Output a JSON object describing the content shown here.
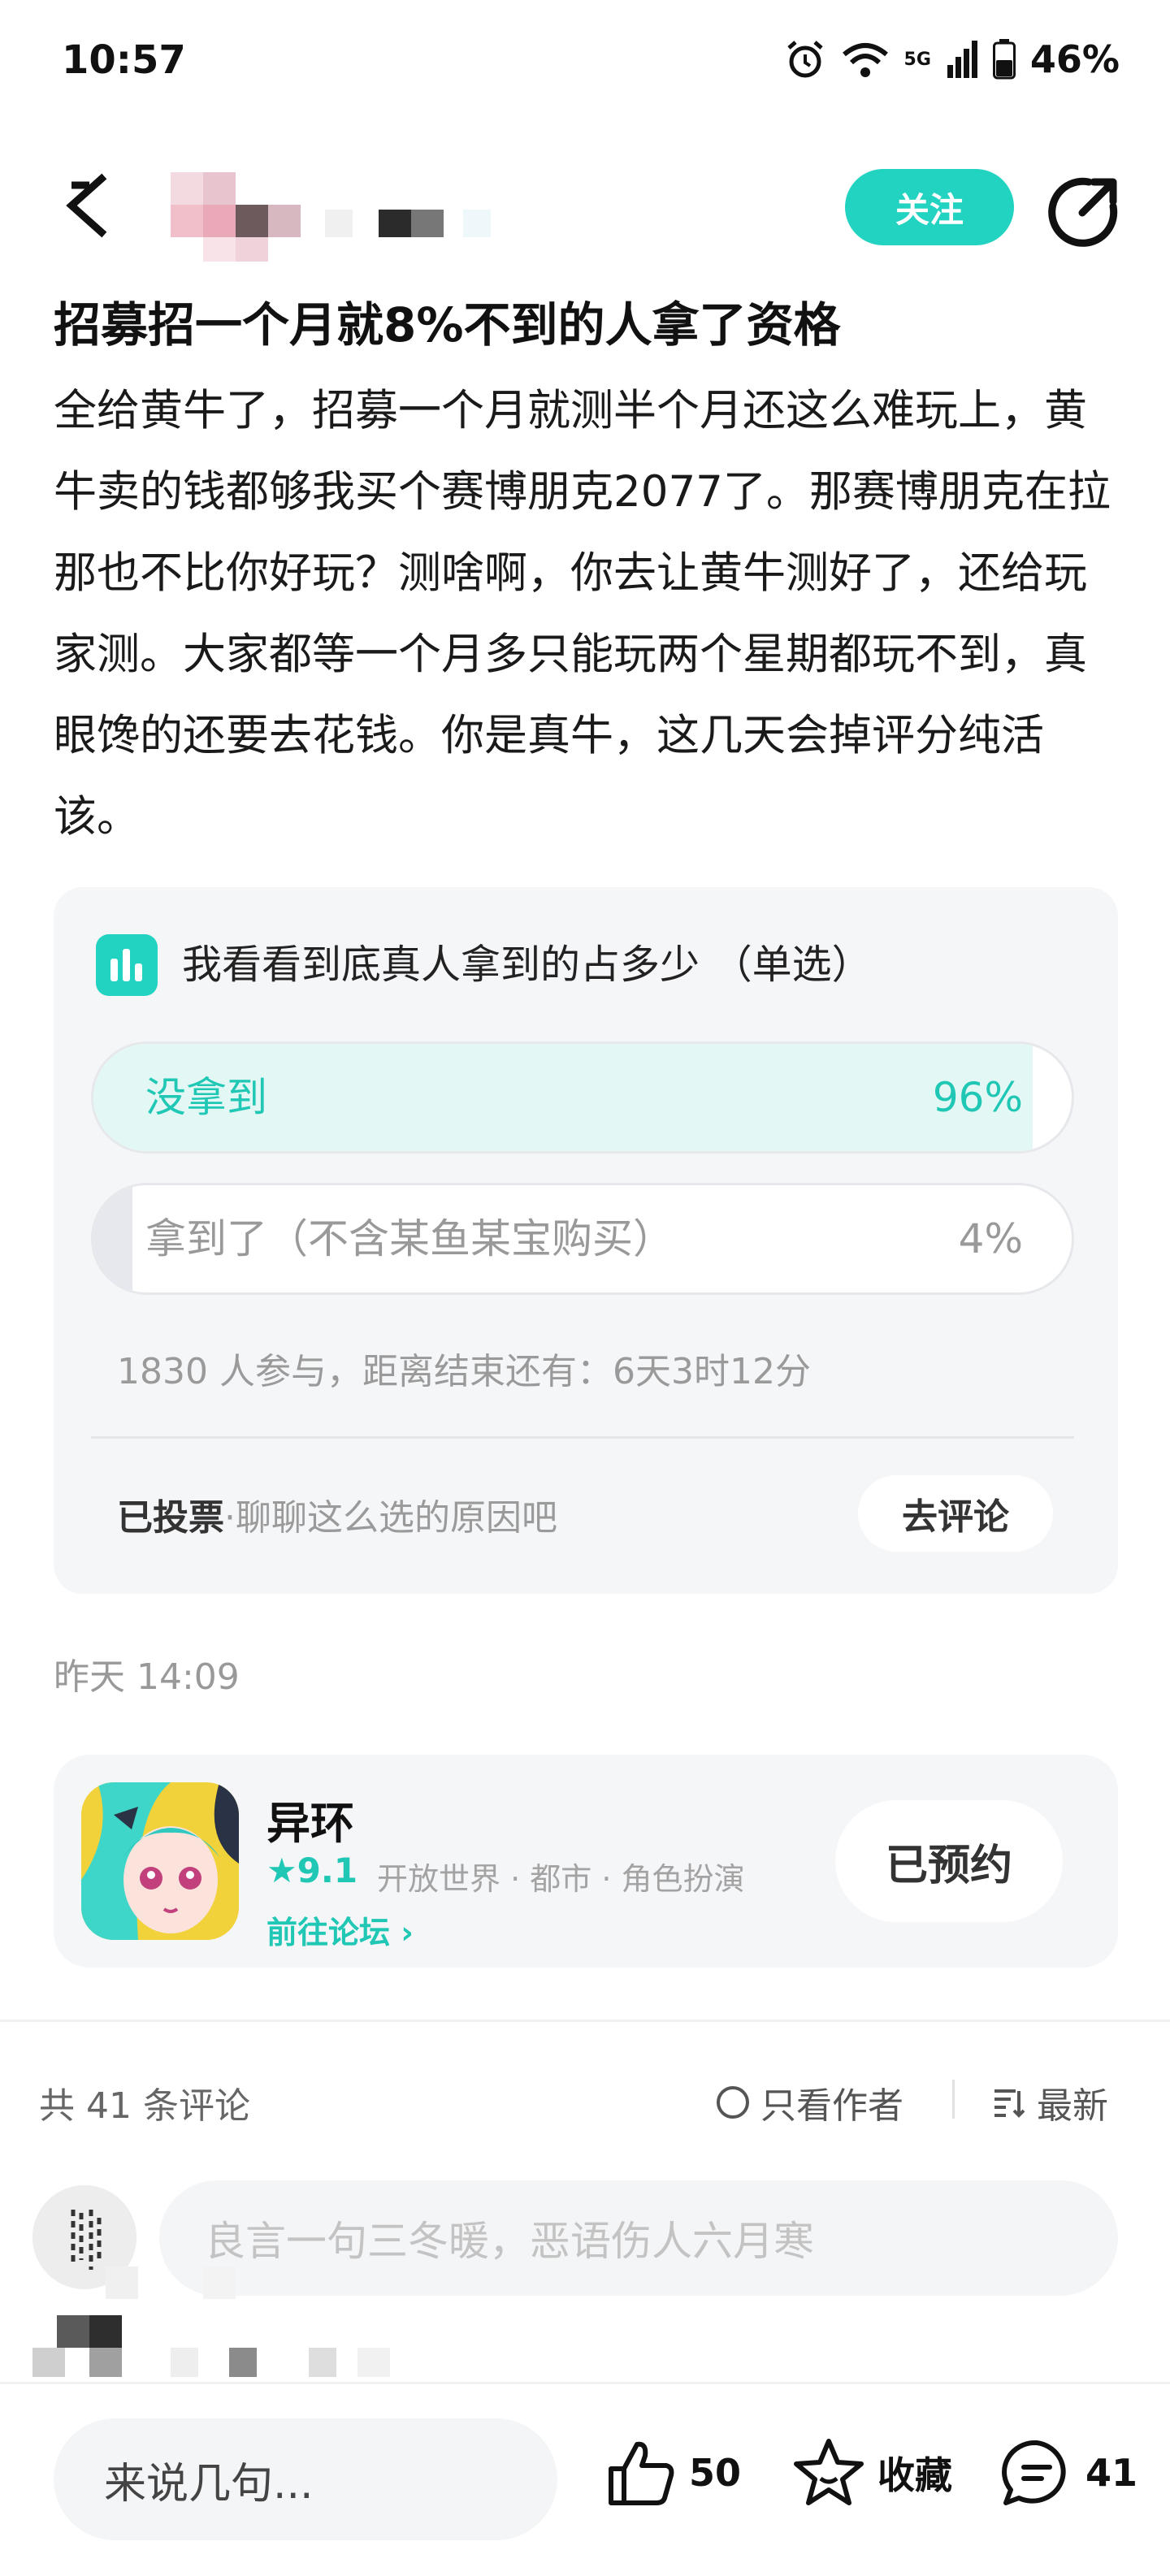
{
  "status_bar": {
    "time": "10:57",
    "network": "5G",
    "battery": "46%",
    "icons": [
      "alarm-icon",
      "wifi-icon",
      "signal-icon",
      "battery-icon"
    ]
  },
  "header": {
    "follow_label": "关注",
    "icons": [
      "back-arrow-icon",
      "share-icon"
    ]
  },
  "post": {
    "title": "招募招一个月就8%不到的人拿了资格",
    "body": "全给黄牛了，招募一个月就测半个月还这么难玩上，黄牛卖的钱都够我买个赛博朋克2077了。那赛博朋克在拉那也不比你好玩？测啥啊，你去让黄牛测好了，还给玩家测。大家都等一个月多只能玩两个星期都玩不到，真眼馋的还要去花钱。你是真牛，这几天会掉评分纯活该。",
    "time": "昨天 14:09"
  },
  "poll": {
    "question": "我看看到底真人拿到的占多少 （单选）",
    "options": [
      {
        "label": "没拿到",
        "percent_label": "96%",
        "fraction": 0.96
      },
      {
        "label": "拿到了（不含某鱼某宝购买）",
        "percent_label": "4%",
        "fraction": 0.04
      }
    ],
    "meta": "1830 人参与，距离结束还有：6天3时12分",
    "voted_label": "已投票",
    "voted_hint": "·聊聊这么选的原因吧",
    "comment_button": "去评论",
    "accent_color": "#21d3c0"
  },
  "game": {
    "name": "异环",
    "rating": "9.1",
    "tags": "开放世界 · 都市 · 角色扮演",
    "forum_link": "前往论坛",
    "reserved_label": "已预约"
  },
  "comments": {
    "count_label": "共 41 条评论",
    "only_author": "只看作者",
    "sort_label": "最新",
    "input_placeholder": "良言一句三冬暖，恶语伤人六月寒"
  },
  "bottom_bar": {
    "input_placeholder": "来说几句...",
    "like_count": "50",
    "favorite_label": "收藏",
    "comment_count": "41"
  }
}
